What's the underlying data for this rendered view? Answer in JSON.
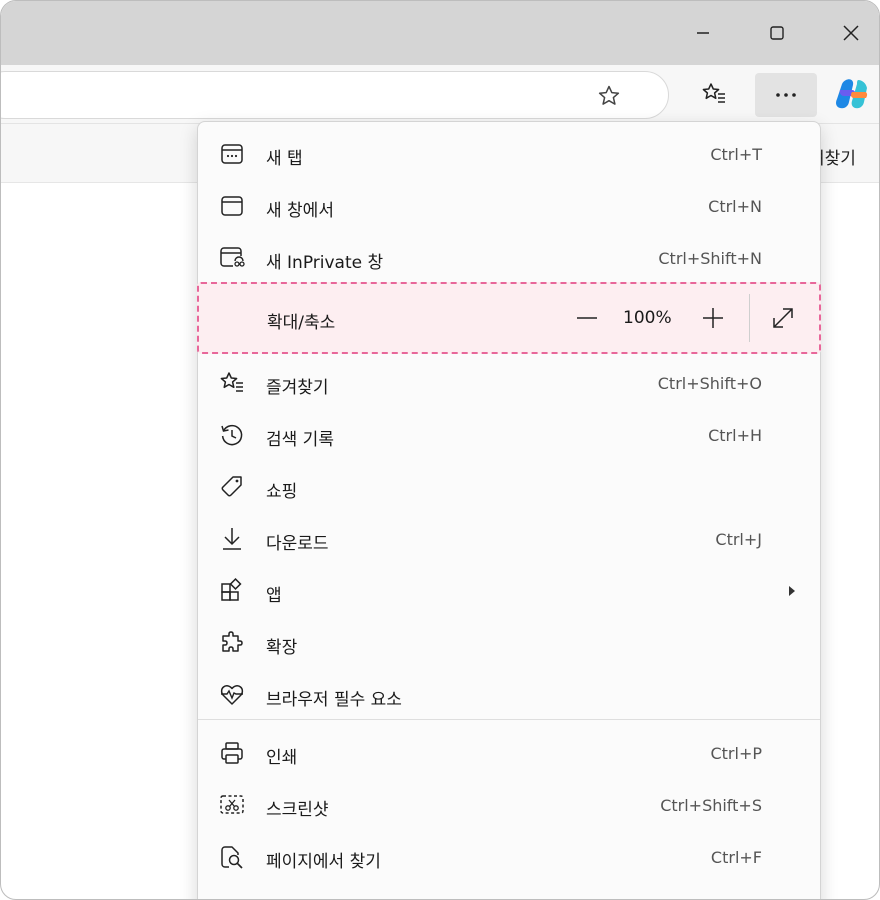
{
  "window": {
    "controls": {
      "minimize_icon": "minimize-icon",
      "maximize_icon": "maximize-icon",
      "close_icon": "close-icon"
    }
  },
  "toolbar": {
    "favorites_icon": "favorites-list-icon",
    "more_icon": "more-dots-icon",
    "copilot_icon": "copilot-icon"
  },
  "favorites_bar": {
    "partial_text": "려찾기"
  },
  "menu": {
    "items_top": [
      {
        "label": "새 탭",
        "shortcut": "Ctrl+T",
        "icon": "new-tab-icon"
      },
      {
        "label": "새 창에서",
        "shortcut": "Ctrl+N",
        "icon": "new-window-icon"
      },
      {
        "label": "새 InPrivate 창",
        "shortcut": "Ctrl+Shift+N",
        "icon": "inprivate-icon"
      }
    ],
    "zoom": {
      "label": "확대/축소",
      "value": "100%"
    },
    "items_middle": [
      {
        "label": "즐겨찾기",
        "shortcut": "Ctrl+Shift+O",
        "icon": "favorites-icon"
      },
      {
        "label": "검색 기록",
        "shortcut": "Ctrl+H",
        "icon": "history-icon"
      },
      {
        "label": "쇼핑",
        "shortcut": "",
        "icon": "shopping-tag-icon"
      },
      {
        "label": "다운로드",
        "shortcut": "Ctrl+J",
        "icon": "download-icon"
      },
      {
        "label": "앱",
        "shortcut": "",
        "icon": "apps-icon"
      },
      {
        "label": "확장",
        "shortcut": "",
        "icon": "extensions-icon"
      },
      {
        "label": "브라우저 필수 요소",
        "shortcut": "",
        "icon": "browser-essentials-icon"
      }
    ],
    "items_bottom": [
      {
        "label": "인쇄",
        "shortcut": "Ctrl+P",
        "icon": "print-icon"
      },
      {
        "label": "스크린샷",
        "shortcut": "Ctrl+Shift+S",
        "icon": "screenshot-icon"
      },
      {
        "label": "페이지에서 찾기",
        "shortcut": "Ctrl+F",
        "icon": "find-in-page-icon"
      }
    ]
  },
  "colors": {
    "titlebar": "#d5d5d5",
    "toolbar": "#f7f7f7",
    "menu_bg": "#fbfbfb",
    "zoom_highlight_bg": "#fdeef1",
    "zoom_highlight_border": "#e8679a",
    "more_button_active": "#e3e3e3"
  }
}
